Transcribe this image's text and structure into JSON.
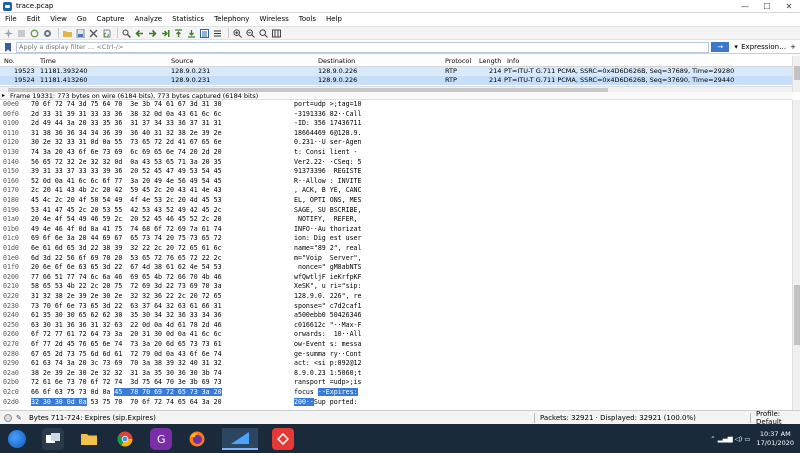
{
  "window": {
    "title": "trace.pcap",
    "minimize": "—",
    "maximize": "☐",
    "close": "✕"
  },
  "menu": [
    "File",
    "Edit",
    "View",
    "Go",
    "Capture",
    "Analyze",
    "Statistics",
    "Telephony",
    "Wireless",
    "Tools",
    "Help"
  ],
  "toolbar_icons": [
    "start-capture-icon",
    "stop-capture-icon",
    "restart-capture-icon",
    "capture-options-icon",
    "open-file-icon",
    "save-file-icon",
    "close-file-icon",
    "reload-file-icon",
    "find-packet-icon",
    "go-back-icon",
    "go-forward-icon",
    "go-to-packet-icon",
    "go-first-icon",
    "go-last-icon",
    "autoscroll-icon",
    "colorize-icon",
    "zoom-in-icon",
    "zoom-out-icon",
    "normal-size-icon",
    "resize-columns-icon"
  ],
  "filter": {
    "placeholder": "Apply a display filter … <Ctrl-/>",
    "apply_icon": "→",
    "expression": "Expression…",
    "plus": "+"
  },
  "packet_list": {
    "columns": [
      "No.",
      "Time",
      "Source",
      "Destination",
      "Protocol",
      "Length",
      "Info"
    ],
    "rows": [
      {
        "no": "19523",
        "time": "11181.393240",
        "source": "128.9.0.231",
        "destination": "128.9.0.226",
        "protocol": "RTP",
        "length": "214",
        "info": "PT=ITU-T G.711 PCMA, SSRC=0x4D6D626B, Seq=37689, Time=29280"
      },
      {
        "no": "19524",
        "time": "11181.413260",
        "source": "128.9.0.231",
        "destination": "128.9.0.226",
        "protocol": "RTP",
        "length": "214",
        "info": "PT=ITU-T G.711 PCMA, SSRC=0x4D6D626B, Seq=37690, Time=29440"
      }
    ]
  },
  "detail": {
    "expander": "▸",
    "text": "Frame 19331: 773 bytes on wire (6184 bits), 773 bytes captured (6184 bits)"
  },
  "hex": [
    {
      "off": "00e0",
      "bytes": "70 6f 72 74 3d 75 64 70  3e 3b 74 61 67 3d 31 30",
      "ascii": "port=udp >;tag=10"
    },
    {
      "off": "00f0",
      "bytes": "2d 33 31 39 31 33 33 36  38 32 0d 0a 43 61 6c 6c",
      "ascii": "-3191336 82··Call"
    },
    {
      "off": "0100",
      "bytes": "2d 49 44 3a 20 33 35 36  31 37 34 33 36 37 31 31",
      "ascii": "-ID: 356 17436711"
    },
    {
      "off": "0110",
      "bytes": "31 38 36 36 34 34 36 39  36 40 31 32 38 2e 39 2e",
      "ascii": "18664469 6@128.9."
    },
    {
      "off": "0120",
      "bytes": "30 2e 32 33 31 0d 0a 55  73 65 72 2d 41 67 65 6e",
      "ascii": "0.231··U ser-Agen"
    },
    {
      "off": "0130",
      "bytes": "74 3a 20 43 6f 6e 73 69  6c 69 65 6e 74 20 2d 20",
      "ascii": "t: Consi lient - "
    },
    {
      "off": "0140",
      "bytes": "56 65 72 32 2e 32 32 0d  0a 43 53 65 71 3a 20 35",
      "ascii": "Ver2.22· ·CSeq: 5"
    },
    {
      "off": "0150",
      "bytes": "39 31 33 37 33 33 39 36  20 52 45 47 49 53 54 45",
      "ascii": "91373396  REGISTE"
    },
    {
      "off": "0160",
      "bytes": "52 0d 0a 41 6c 6c 6f 77  3a 20 49 4e 56 49 54 45",
      "ascii": "R··Allow : INVITE"
    },
    {
      "off": "0170",
      "bytes": "2c 20 41 43 4b 2c 20 42  59 45 2c 20 43 41 4e 43",
      "ascii": ", ACK, B YE, CANC"
    },
    {
      "off": "0180",
      "bytes": "45 4c 2c 20 4f 50 54 49  4f 4e 53 2c 20 4d 45 53",
      "ascii": "EL, OPTI ONS, MES"
    },
    {
      "off": "0190",
      "bytes": "53 41 47 45 2c 20 53 55  42 53 43 52 49 42 45 2c",
      "ascii": "SAGE, SU BSCRIBE,"
    },
    {
      "off": "01a0",
      "bytes": "20 4e 4f 54 49 46 59 2c  20 52 45 46 45 52 2c 20",
      "ascii": " NOTIFY,  REFER, "
    },
    {
      "off": "01b0",
      "bytes": "49 4e 46 4f 0d 0a 41 75  74 68 6f 72 69 7a 61 74",
      "ascii": "INFO··Au thorizat"
    },
    {
      "off": "01c0",
      "bytes": "69 6f 6e 3a 20 44 69 67  65 73 74 20 75 73 65 72",
      "ascii": "ion: Dig est user"
    },
    {
      "off": "01d0",
      "bytes": "6e 61 6d 65 3d 22 38 39  32 22 2c 20 72 65 61 6c",
      "ascii": "name=\"89 2\", real"
    },
    {
      "off": "01e0",
      "bytes": "6d 3d 22 56 6f 69 70 20  53 65 72 76 65 72 22 2c",
      "ascii": "m=\"Voip  Server\","
    },
    {
      "off": "01f0",
      "bytes": "20 6e 6f 6e 63 65 3d 22  67 4d 38 61 62 4e 54 53",
      "ascii": " nonce=\" gM8abNTS"
    },
    {
      "off": "0200",
      "bytes": "77 66 51 77 74 6c 6a 46  69 65 4b 72 66 70 4b 46",
      "ascii": "wfQwtljF ieKrfpKF"
    },
    {
      "off": "0210",
      "bytes": "58 65 53 4b 22 2c 20 75  72 69 3d 22 73 69 70 3a",
      "ascii": "XeSK\", u ri=\"sip:"
    },
    {
      "off": "0220",
      "bytes": "31 32 38 2e 39 2e 30 2e  32 32 36 22 2c 20 72 65",
      "ascii": "128.9.0. 226\", re"
    },
    {
      "off": "0230",
      "bytes": "73 70 6f 6e 73 65 3d 22  63 37 64 32 63 61 66 31",
      "ascii": "sponse=\" c7d2caf1"
    },
    {
      "off": "0240",
      "bytes": "61 35 30 30 65 62 62 30  35 30 34 32 36 33 34 36",
      "ascii": "a500ebb0 50426346"
    },
    {
      "off": "0250",
      "bytes": "63 30 31 36 36 31 32 63  22 0d 0a 4d 61 78 2d 46",
      "ascii": "c016612c \"··Max-F"
    },
    {
      "off": "0260",
      "bytes": "6f 72 77 61 72 64 73 3a  20 31 30 0d 0a 41 6c 6c",
      "ascii": "orwards:  10··All"
    },
    {
      "off": "0270",
      "bytes": "6f 77 2d 45 76 65 6e 74  73 3a 20 6d 65 73 73 61",
      "ascii": "ow-Event s: messa"
    },
    {
      "off": "0280",
      "bytes": "67 65 2d 73 75 6d 6d 61  72 79 0d 0a 43 6f 6e 74",
      "ascii": "ge-summa ry··Cont"
    },
    {
      "off": "0290",
      "bytes": "61 63 74 3a 20 3c 73 69  70 3a 38 39 32 40 31 32",
      "ascii": "act: <si p:892@12"
    },
    {
      "off": "02a0",
      "bytes": "38 2e 39 2e 30 2e 32 32  31 3a 35 30 36 30 3b 74",
      "ascii": "8.9.0.23 1:5060;t"
    },
    {
      "off": "02b0",
      "bytes": "72 61 6e 73 70 6f 72 74  3d 75 64 70 3e 3b 69 73",
      "ascii": "ransport =udp>;is"
    },
    {
      "off": "02c0",
      "bytes_plain": "66 6f 63 75 73 0d 0a ",
      "bytes_hl": "45  78 70 69 72 65 73 3a 20",
      "ascii_plain": "focus",
      "ascii_hl": "··Expires:"
    },
    {
      "off": "02d0",
      "bytes_hl": "32 30 30 0d 0a",
      "bytes_plain": " 53 75 70  70 6f 72 74 65 64 3a 20",
      "ascii_hl": "200··",
      "ascii_plain": "Sup ported:"
    },
    {
      "off": "02e0",
      "bytes": "74 69 6d 65 72 2c 20 72  65 70 6c 61 63 65 73 0d",
      "ascii": "timer,re places·"
    },
    {
      "off": "02f0",
      "bytes": "43 6f 6e 74 65 6e 74 2d  4c 65 6e 67 74 68 3a 20",
      "ascii": "Content- Length: "
    },
    {
      "off": "0300",
      "bytes": "30 0d 0a 0d 0a",
      "ascii": "0····"
    }
  ],
  "status": {
    "left": "Bytes 711-724: Expires (sip.Expires)",
    "packets": "Packets: 32921 · Displayed: 32921 (100.0%)",
    "profile": "Profile: Default"
  },
  "taskbar": {
    "time": "10:37 AM",
    "date": "17/01/2020",
    "tray_icons": "⌃ ▂▄▆ ◁) ▭"
  },
  "colors": {
    "selection": "#3a7ad9",
    "row_rtp_a": "#d7e9fb",
    "row_rtp_b": "#c6def8",
    "taskbar": "#1b2a3a"
  }
}
